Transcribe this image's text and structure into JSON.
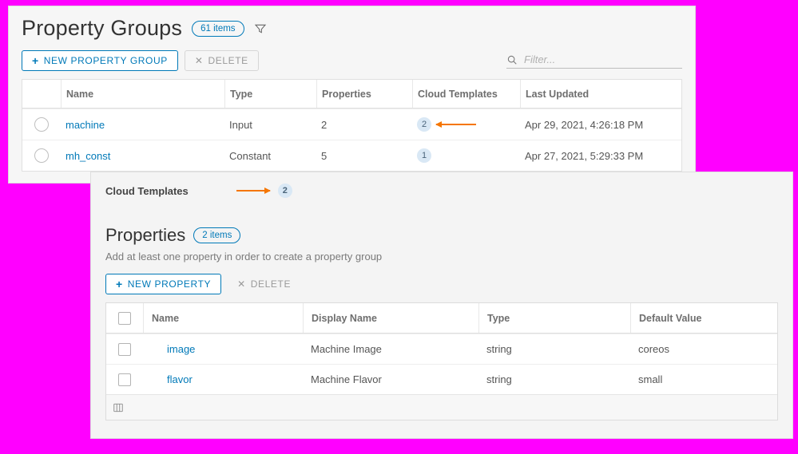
{
  "colors": {
    "accent": "#0079b8",
    "highlight": "#f57600",
    "badge_bg": "#d9e8f5"
  },
  "top": {
    "title": "Property Groups",
    "count_label": "61 items",
    "new_btn": "NEW PROPERTY GROUP",
    "delete_btn": "DELETE",
    "filter_placeholder": "Filter...",
    "columns": {
      "name": "Name",
      "type": "Type",
      "properties": "Properties",
      "cloud_templates": "Cloud Templates",
      "last_updated": "Last Updated"
    },
    "rows": [
      {
        "name": "machine",
        "type": "Input",
        "properties": "2",
        "cloud_templates": "2",
        "last_updated": "Apr 29, 2021, 4:26:18 PM",
        "arrow": true
      },
      {
        "name": "mh_const",
        "type": "Constant",
        "properties": "5",
        "cloud_templates": "1",
        "last_updated": "Apr 27, 2021, 5:29:33 PM",
        "arrow": false
      }
    ]
  },
  "detail": {
    "ct_label": "Cloud Templates",
    "ct_count": "2",
    "props_title": "Properties",
    "props_count": "2 items",
    "helper_text": "Add at least one property in order to create a property group",
    "new_btn": "NEW PROPERTY",
    "delete_btn": "DELETE",
    "columns": {
      "name": "Name",
      "display_name": "Display Name",
      "type": "Type",
      "default_value": "Default Value"
    },
    "rows": [
      {
        "name": "image",
        "display_name": "Machine Image",
        "type": "string",
        "default_value": "coreos"
      },
      {
        "name": "flavor",
        "display_name": "Machine Flavor",
        "type": "string",
        "default_value": "small"
      }
    ]
  }
}
